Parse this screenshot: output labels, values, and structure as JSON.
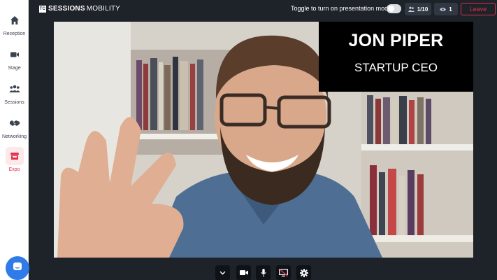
{
  "sidebar": {
    "items": [
      {
        "label": "Reception",
        "icon": "home-icon"
      },
      {
        "label": "Stage",
        "icon": "video-camera-icon"
      },
      {
        "label": "Sessions",
        "icon": "people-group-icon"
      },
      {
        "label": "Networking",
        "icon": "handshake-icon"
      },
      {
        "label": "Expo",
        "icon": "booth-icon",
        "active": true
      }
    ],
    "help_icon": "chat-bubble-icon"
  },
  "header": {
    "brand_bold": "SESSIONS",
    "brand_light": "MOBILITY",
    "brand_mark": "TC",
    "toggle_label": "Toggle to turn on presentation mode",
    "presentation_mode": false,
    "attendees": "1/10",
    "views": "1",
    "leave_label": "Leave"
  },
  "stage": {
    "speaker_name": "JON PIPER",
    "speaker_title": "STARTUP CEO"
  },
  "controls": {
    "buttons": [
      "chevron-down-icon",
      "video-camera-icon",
      "microphone-icon",
      "screen-share-icon",
      "gear-icon"
    ]
  },
  "colors": {
    "accent": "#e0314b",
    "background": "#1e2229",
    "help": "#2f7bea"
  }
}
